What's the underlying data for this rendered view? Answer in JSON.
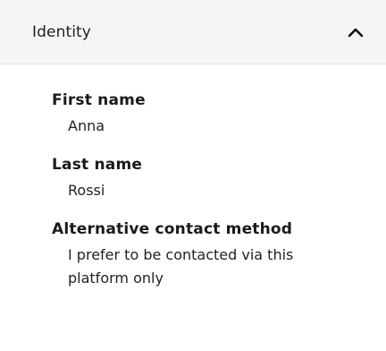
{
  "section": {
    "title": "Identity",
    "toggle_icon": "chevron-up-icon"
  },
  "fields": [
    {
      "label": "First name",
      "value": "Anna"
    },
    {
      "label": "Last name",
      "value": "Rossi"
    },
    {
      "label": "Alternative contact method",
      "value": "I prefer to be contacted via this platform only"
    }
  ]
}
